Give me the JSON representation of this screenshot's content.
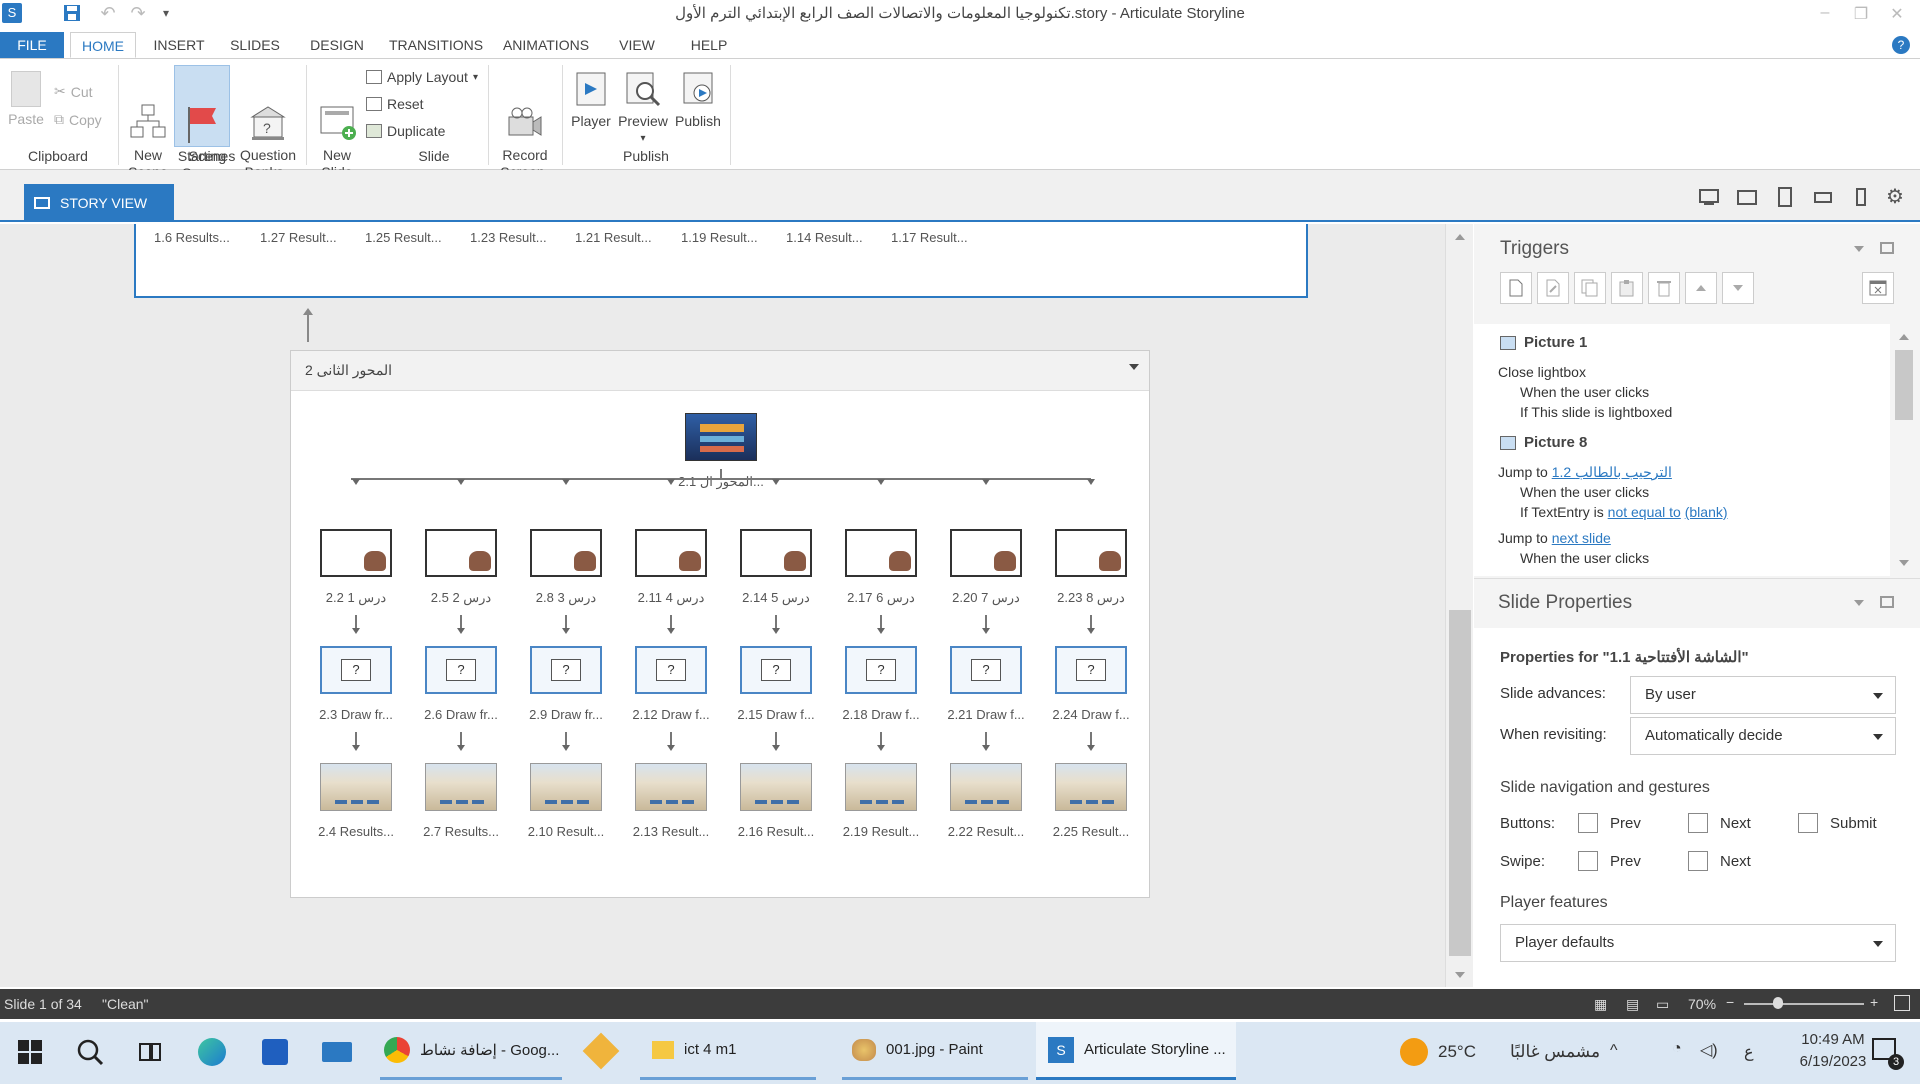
{
  "window": {
    "title": "تكنولوجيا المعلومات والاتصالات الصف الرابع الإبتدائي الترم الأول.story -  Articulate Storyline"
  },
  "tabs": [
    {
      "label": "FILE"
    },
    {
      "label": "HOME"
    },
    {
      "label": "INSERT"
    },
    {
      "label": "SLIDES"
    },
    {
      "label": "DESIGN"
    },
    {
      "label": "TRANSITIONS"
    },
    {
      "label": "ANIMATIONS"
    },
    {
      "label": "VIEW"
    },
    {
      "label": "HELP"
    }
  ],
  "ribbon": {
    "clipboard": {
      "paste": "Paste",
      "cut": "Cut",
      "copy": "Copy",
      "group": "Clipboard"
    },
    "scenes": {
      "new_scene": "New\nScene",
      "starting_scene": "Starting\nScene",
      "question_banks": "Question\nBanks",
      "group": "Scenes"
    },
    "slide": {
      "new_slide": "New\nSlide",
      "apply_layout": "Apply Layout",
      "reset": "Reset",
      "duplicate": "Duplicate",
      "group": "Slide"
    },
    "record": {
      "label": "Record\nScreen"
    },
    "publish": {
      "player": "Player",
      "preview": "Preview",
      "publish": "Publish",
      "group": "Publish"
    }
  },
  "story_view": {
    "tab_label": "STORY VIEW"
  },
  "scene1": {
    "labels": [
      "1.6 Results...",
      "1.27 Result...",
      "1.25 Result...",
      "1.23 Result...",
      "1.21 Result...",
      "1.19 Result...",
      "1.14 Result...",
      "1.17 Result..."
    ]
  },
  "scene2": {
    "title": "المحور الثانى 2",
    "root_label": "2.1 المحور ال...",
    "lessons": [
      "2.2 درس 1",
      "2.5 درس 2",
      "2.8 درس 3",
      "2.11 درس 4",
      "2.14 درس 5",
      "2.17 درس 6",
      "2.20 درس 7",
      "2.23 درس 8"
    ],
    "quizzes": [
      "2.3 Draw fr...",
      "2.6 Draw fr...",
      "2.9 Draw fr...",
      "2.12 Draw f...",
      "2.15 Draw f...",
      "2.18 Draw f...",
      "2.21 Draw f...",
      "2.24 Draw f..."
    ],
    "results": [
      "2.4 Results...",
      "2.7 Results...",
      "2.10 Result...",
      "2.13 Result...",
      "2.16 Result...",
      "2.19 Result...",
      "2.22 Result...",
      "2.25 Result..."
    ]
  },
  "triggers": {
    "title": "Triggers",
    "items": [
      {
        "object": "Picture 1"
      },
      {
        "action": "Close lightbox"
      },
      {
        "when": "When the user clicks"
      },
      {
        "cond": "If This slide is lightboxed"
      },
      {
        "object": "Picture 8"
      },
      {
        "action": "Jump to ",
        "link": "1.2 الترحيب بالطالب"
      },
      {
        "when": "When the user clicks"
      },
      {
        "cond_prefix": "If TextEntry is ",
        "cond_link1": "not equal to",
        "cond_link2": "(blank)"
      },
      {
        "action": "Jump to ",
        "link": "next slide"
      },
      {
        "when": "When the user clicks"
      }
    ]
  },
  "slide_properties": {
    "title": "Slide Properties",
    "properties_for": "Properties for \"1.1 الشاشة الأفتتاحية\"",
    "slide_advances_label": "Slide advances:",
    "slide_advances_value": "By user",
    "when_revisiting_label": "When revisiting:",
    "when_revisiting_value": "Automatically decide",
    "nav_heading": "Slide navigation and gestures",
    "buttons_label": "Buttons:",
    "swipe_label": "Swipe:",
    "prev": "Prev",
    "next": "Next",
    "submit": "Submit",
    "player_features": "Player features",
    "player_value": "Player defaults"
  },
  "status": {
    "slide": "Slide 1 of 34",
    "state": "\"Clean\"",
    "zoom": "70%"
  },
  "taskbar": {
    "apps": [
      {
        "label": "إضافة نشاط - Goog..."
      },
      {
        "label": "ict 4  m1"
      },
      {
        "label": "001.jpg - Paint"
      },
      {
        "label": "Articulate Storyline ..."
      }
    ],
    "weather_temp": "25°C",
    "weather_text": "مشمس غالبًا",
    "lang": "ع",
    "time": "10:49 AM",
    "date": "6/19/2023",
    "notif_count": "3"
  },
  "colors": {
    "accent": "#2b79c2",
    "status_bar": "#3c3c3c",
    "taskbar": "#dbe7f3"
  }
}
